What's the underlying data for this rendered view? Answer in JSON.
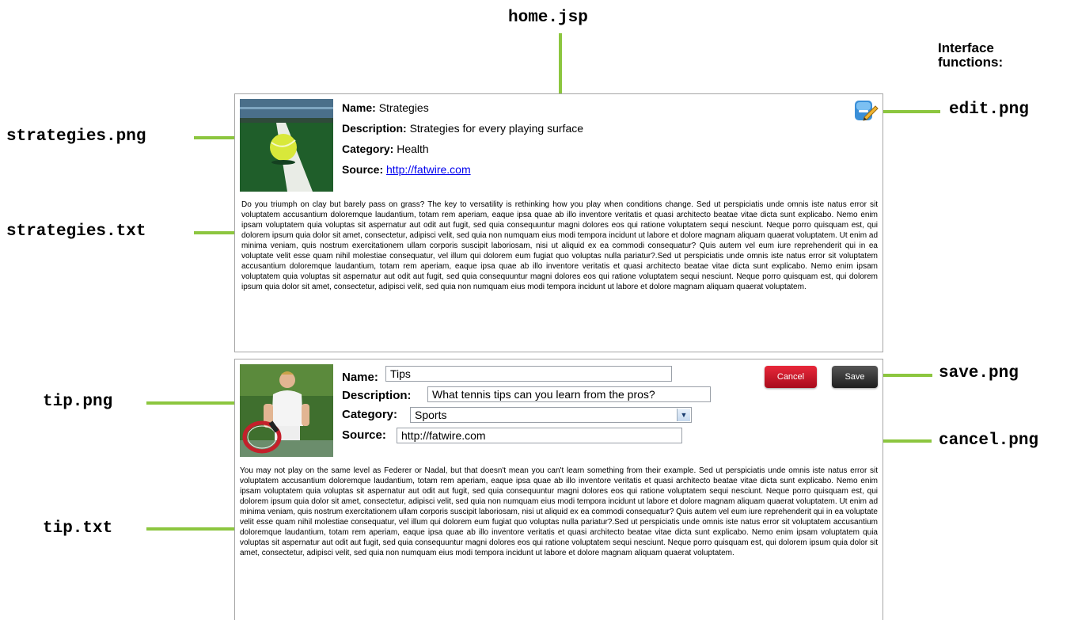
{
  "labels": {
    "top": "home.jsp",
    "interface_functions": "Interface functions:",
    "edit": "edit.png",
    "save": "save.png",
    "cancel": "cancel.png",
    "strategies_png": "strategies.png",
    "strategies_txt": "strategies.txt",
    "tip_png": "tip.png",
    "tip_txt": "tip.txt"
  },
  "colors": {
    "connector": "#8cc63f",
    "cancel_button": "#c8102e",
    "save_button": "#2b2b2b",
    "link": "#0000ee"
  },
  "strategies": {
    "name_label": "Name:",
    "name": "Strategies",
    "description_label": "Description:",
    "description": "Strategies for every playing surface",
    "category_label": "Category:",
    "category": "Health",
    "source_label": "Source:",
    "source": "http://fatwire.com",
    "edit_icon": "edit-pencil-icon",
    "body": "Do you triumph on clay but barely pass on grass? The key to versatility is rethinking how you play when conditions change. Sed ut perspiciatis unde omnis iste natus error sit voluptatem accusantium doloremque laudantium, totam rem aperiam, eaque ipsa quae ab illo inventore veritatis et quasi architecto beatae vitae dicta sunt explicabo. Nemo enim ipsam voluptatem quia voluptas sit aspernatur aut odit aut fugit, sed quia consequuntur magni dolores eos qui ratione voluptatem sequi nesciunt. Neque porro quisquam est, qui dolorem ipsum quia dolor sit amet, consectetur, adipisci velit, sed quia non numquam eius modi tempora incidunt ut labore et dolore magnam aliquam quaerat voluptatem. Ut enim ad minima veniam, quis nostrum exercitationem ullam corporis suscipit laboriosam, nisi ut aliquid ex ea commodi consequatur? Quis autem vel eum iure reprehenderit qui in ea voluptate velit esse quam nihil molestiae consequatur, vel illum qui dolorem eum fugiat quo voluptas nulla pariatur?.Sed ut perspiciatis unde omnis iste natus error sit voluptatem accusantium doloremque laudantium, totam rem aperiam, eaque ipsa quae ab illo inventore veritatis et quasi architecto beatae vitae dicta sunt explicabo. Nemo enim ipsam voluptatem quia voluptas sit aspernatur aut odit aut fugit, sed quia consequuntur magni dolores eos qui ratione voluptatem sequi nesciunt. Neque porro quisquam est, qui dolorem ipsum quia dolor sit amet, consectetur, adipisci velit, sed quia non numquam eius modi tempora incidunt ut labore et dolore magnam aliquam quaerat voluptatem."
  },
  "tip": {
    "name_label": "Name:",
    "name": "Tips",
    "description_label": "Description:",
    "description": "What tennis tips can you learn from the pros?",
    "category_label": "Category:",
    "category": "Sports",
    "source_label": "Source:",
    "source": "http://fatwire.com",
    "cancel_label": "Cancel",
    "save_label": "Save",
    "body": "You may not play on the same level as Federer or Nadal, but that doesn't mean you can't learn something from their example. Sed ut perspiciatis unde omnis iste natus error sit voluptatem accusantium doloremque laudantium, totam rem aperiam, eaque ipsa quae ab illo inventore veritatis et quasi architecto beatae vitae dicta sunt explicabo. Nemo enim ipsam voluptatem quia voluptas sit aspernatur aut odit aut fugit, sed quia consequuntur magni dolores eos qui ratione voluptatem sequi nesciunt. Neque porro quisquam est, qui dolorem ipsum quia dolor sit amet, consectetur, adipisci velit, sed quia non numquam eius modi tempora incidunt ut labore et dolore magnam aliquam quaerat voluptatem. Ut enim ad minima veniam, quis nostrum exercitationem ullam corporis suscipit laboriosam, nisi ut aliquid ex ea commodi consequatur? Quis autem vel eum iure reprehenderit qui in ea voluptate velit esse quam nihil molestiae consequatur, vel illum qui dolorem eum fugiat quo voluptas nulla pariatur?.Sed ut perspiciatis unde omnis iste natus error sit voluptatem accusantium doloremque laudantium, totam rem aperiam, eaque ipsa quae ab illo inventore veritatis et quasi architecto beatae vitae dicta sunt explicabo. Nemo enim ipsam voluptatem quia voluptas sit aspernatur aut odit aut fugit, sed quia consequuntur magni dolores eos qui ratione voluptatem sequi nesciunt. Neque porro quisquam est, qui dolorem ipsum quia dolor sit amet, consectetur, adipisci velit, sed quia non numquam eius modi tempora incidunt ut labore et dolore magnam aliquam quaerat voluptatem."
  }
}
